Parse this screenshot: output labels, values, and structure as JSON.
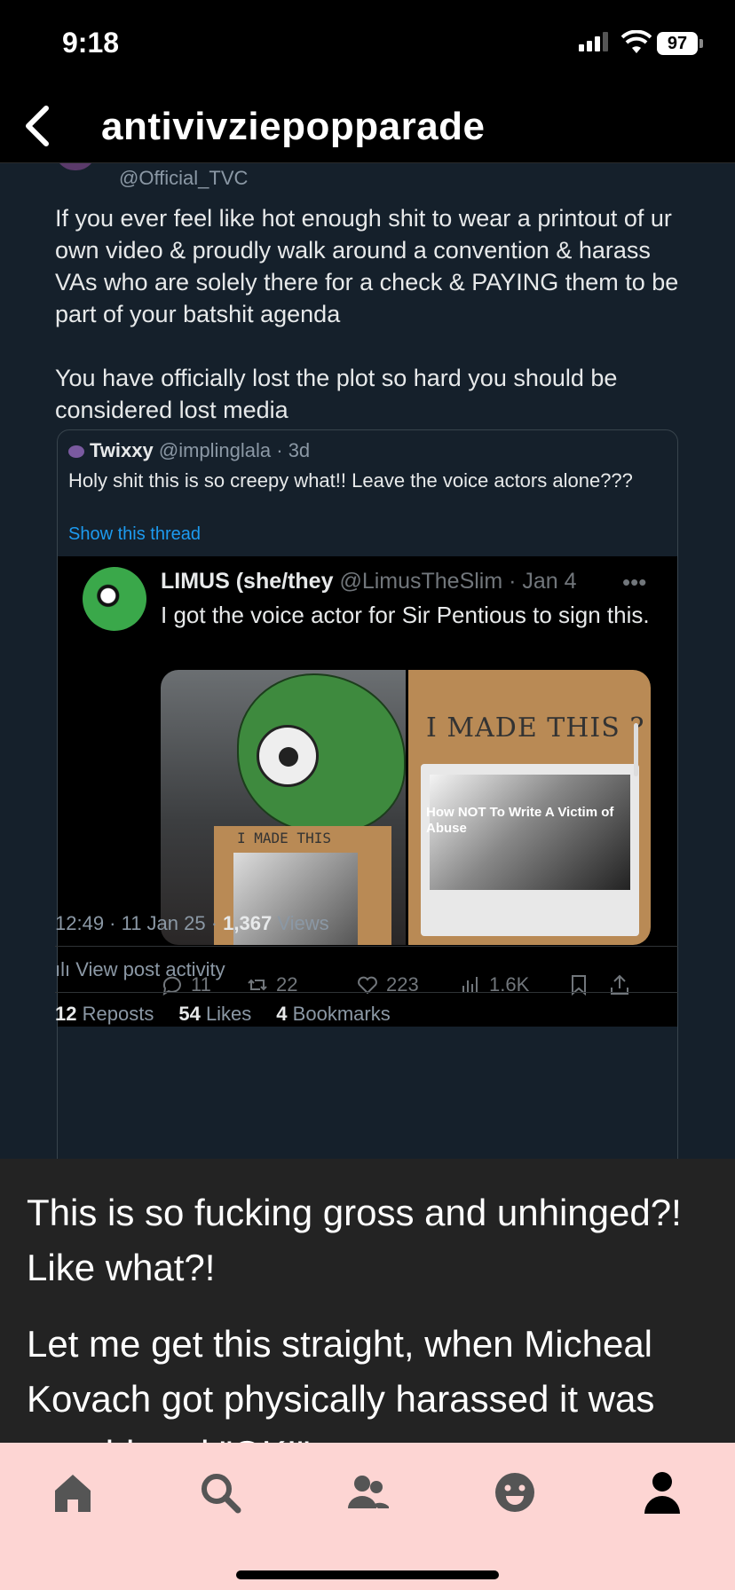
{
  "status_bar": {
    "time": "9:18",
    "battery": "97"
  },
  "header": {
    "title": "antivivziepopparade"
  },
  "tweet": {
    "handle": "@Official_TVC",
    "paragraphs": [
      "If you ever feel like hot enough shit to wear a printout of ur own video & proudly walk around a convention & harass VAs who are solely there for a check & PAYING them to be part of your batshit agenda",
      "You have officially lost the plot so hard you should be considered lost media"
    ],
    "quote": {
      "name": "Twixxy",
      "meta": "@implinglala · 3d",
      "text": "Holy shit this is so creepy what!! Leave the voice actors alone???",
      "show_thread": "Show this thread",
      "inner": {
        "name": "LIMUS (she/they",
        "meta": "@LimusTheSlim · Jan 4",
        "text": "I got the voice actor for Sir Pentious to sign this.",
        "media": {
          "left_sign_text": "I MADE THIS",
          "right_sign_text": "I MADE THIS ?",
          "poster_caption": "How NOT To Write A Victim of Abuse"
        },
        "actions": {
          "replies": "11",
          "reposts": "22",
          "likes": "223",
          "views": "1.6K"
        }
      }
    },
    "timestamp": "12:49 · 11 Jan 25 · ",
    "views_count": "1,367",
    "views_label": " Views",
    "activity": "View post activity",
    "stats": {
      "reposts_count": "12",
      "reposts_label": "Reposts",
      "likes_count": "54",
      "likes_label": "Likes",
      "bookmarks_count": "4",
      "bookmarks_label": "Bookmarks"
    }
  },
  "caption": {
    "paragraph1": "This is so fucking gross and unhinged?! Like what?!",
    "paragraph2": "Let me get this straight, when Micheal Kovach got physically harassed it was considered \"OK!\""
  },
  "bottom_nav": {
    "items": [
      "home-icon",
      "search-icon",
      "community-icon",
      "activity-face-icon",
      "account-icon"
    ],
    "background": "#fdd5d3"
  },
  "colors": {
    "tweet_bg": "#15202b",
    "link_blue": "#1d9bf0",
    "caption_bg": "#232323"
  }
}
